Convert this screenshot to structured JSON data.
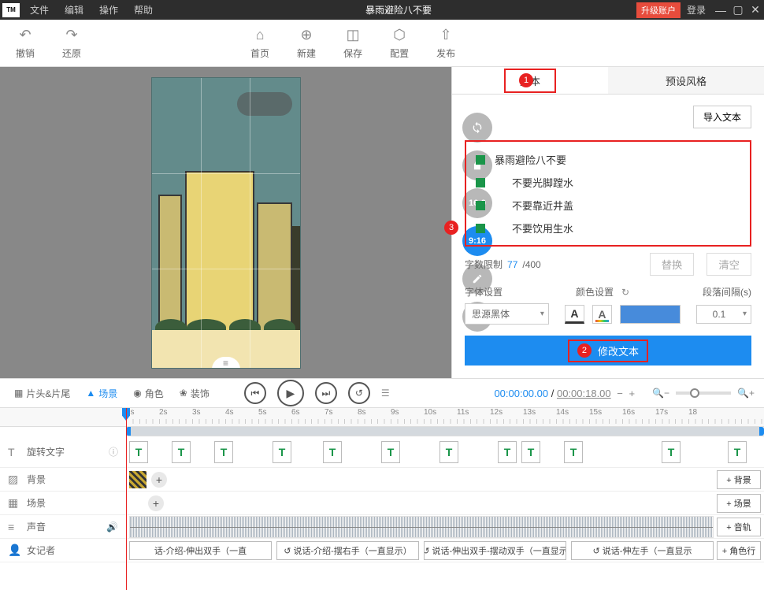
{
  "titlebar": {
    "logo": "TM",
    "menus": [
      "文件",
      "编辑",
      "操作",
      "帮助"
    ],
    "title": "暴雨避险八不要",
    "upgrade": "升级账户",
    "login": "登录"
  },
  "toolbar": {
    "undo": "撤销",
    "redo": "还原",
    "home": "首页",
    "new": "新建",
    "save": "保存",
    "config": "配置",
    "publish": "发布"
  },
  "ratios": {
    "r169": "16:9",
    "r916": "9:16"
  },
  "right": {
    "tab_text": "文本",
    "tab_preset": "预设风格",
    "marker1": "1",
    "marker2": "2",
    "marker3": "3",
    "import": "导入文本",
    "items": [
      "暴雨避险八不要",
      "不要光脚蹚水",
      "不要靠近井盖",
      "不要饮用生水"
    ],
    "count_label": "字数限制",
    "count_cur": "77",
    "count_sep": " /400",
    "replace": "替换",
    "clear": "清空",
    "font_label": "字体设置",
    "color_label": "颜色设置",
    "gap_label": "段落间隔(s)",
    "font": "思源黑体",
    "gap": "0.1",
    "modify": "修改文本"
  },
  "controls": {
    "tabs": {
      "clips": "片头&片尾",
      "scene": "场景",
      "role": "角色",
      "deco": "装饰"
    },
    "time_cur": "00:00:00.00",
    "time_dur": "00:00:18.00"
  },
  "ruler": [
    "1s",
    "2s",
    "3s",
    "4s",
    "5s",
    "6s",
    "7s",
    "8s",
    "9s",
    "10s",
    "11s",
    "12s",
    "13s",
    "14s",
    "15s",
    "16s",
    "17s",
    "18"
  ],
  "tracks": {
    "rotate": "旋转文字",
    "bg": "背景",
    "scene": "场景",
    "sound": "声音",
    "reporter": "女记者",
    "btn_bg": "+ 背景",
    "btn_scene": "+ 场景",
    "btn_audio": "+ 音轨",
    "btn_role": "+ 角色行"
  },
  "actions": [
    "话-介绍-伸出双手（一直",
    "↺ 说话-介绍-摆右手（一直显示）",
    "↺ 说话-伸出双手-摆动双手（一直显示",
    "↺ 说话-伸左手（一直显示"
  ]
}
